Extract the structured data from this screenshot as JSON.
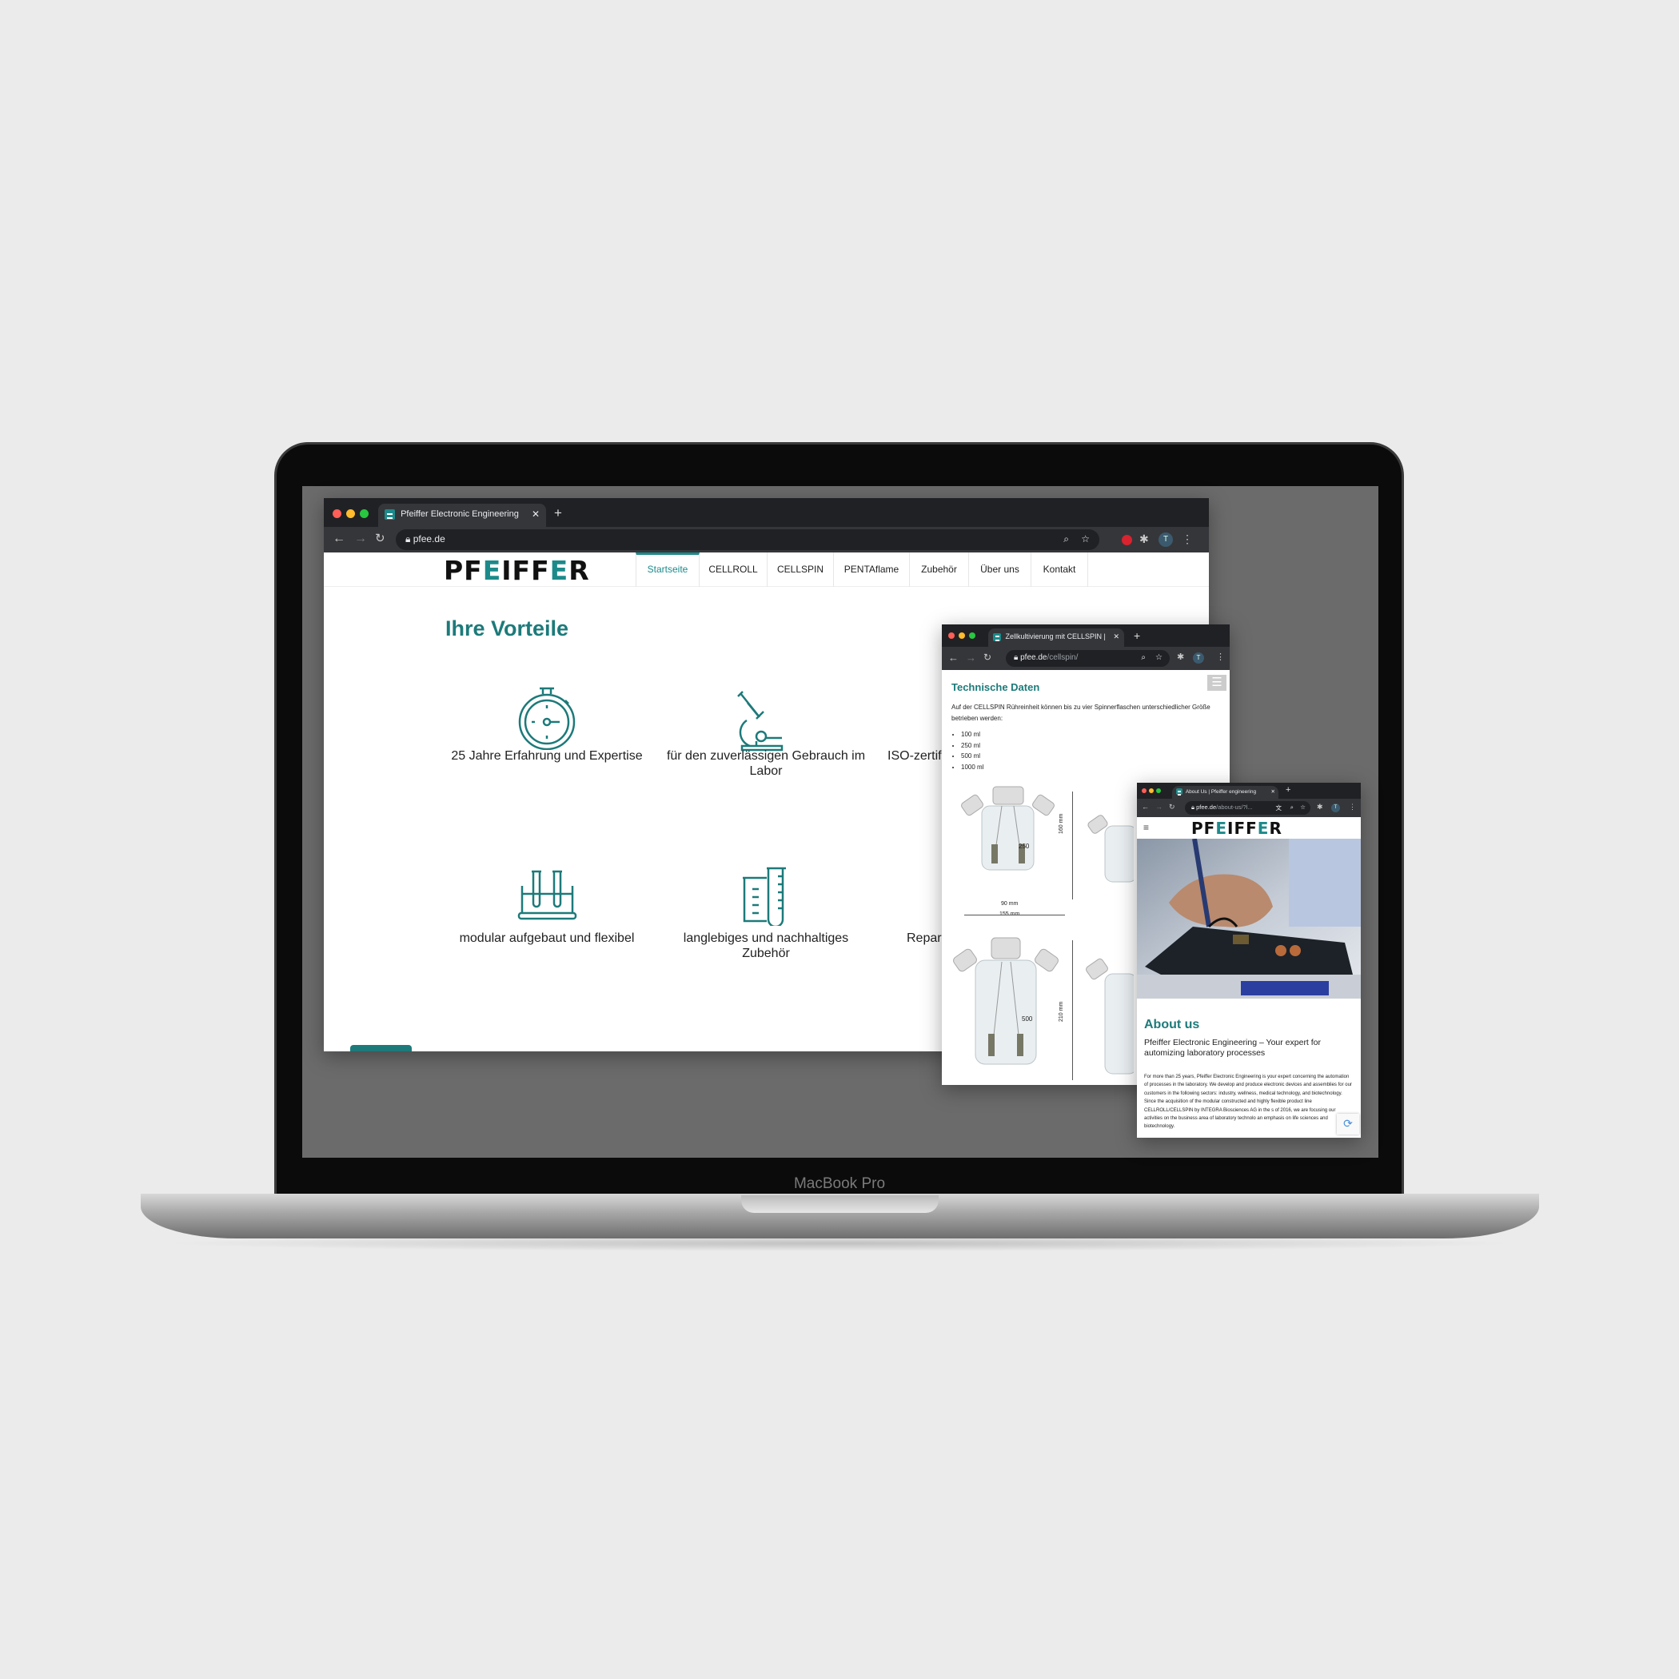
{
  "device": {
    "label": "MacBook Pro"
  },
  "colors": {
    "accent": "#1d7a7a",
    "browser_chrome": "#202124",
    "background": "#ebebeb"
  },
  "main_browser": {
    "tab_title": "Pfeiffer Electronic Engineering",
    "url": "pfee.de",
    "logo": {
      "pre": "PF",
      "e1": "E",
      "mid": "IFF",
      "e2": "E",
      "post": "R"
    },
    "nav": [
      "Startseite",
      "CELLROLL",
      "CELLSPIN",
      "PENTAflame",
      "Zubehör",
      "Über uns",
      "Kontakt"
    ],
    "active_nav": "Startseite",
    "heading": "Ihre Vorteile",
    "features": [
      {
        "icon": "stopwatch-icon",
        "text": "25 Jahre Erfahrung und Expertise"
      },
      {
        "icon": "microscope-icon",
        "text": "für den zuverlässigen Gebrauch im Labor"
      },
      {
        "icon": "certificate-icon",
        "text": "ISO-zertifi"
      },
      {
        "icon": "test-tube-rack-icon",
        "text": "modular aufgebaut und flexibel"
      },
      {
        "icon": "beaker-icon",
        "text": "langlebiges und nachhaltiges Zubehör"
      },
      {
        "icon": "repair-icon",
        "text": "Repar"
      }
    ],
    "avatar": "T"
  },
  "cellspin_browser": {
    "tab_title": "Zellkultivierung mit CELLSPIN |",
    "url_host": "pfee.de",
    "url_path": "/cellspin/",
    "heading": "Technische Daten",
    "intro": "Auf der CELLSPIN Rühreinheit können bis zu vier Spinnerflaschen unterschiedlicher Größe betrieben werden:",
    "sizes": [
      "100 ml",
      "250 ml",
      "500 ml",
      "1000 ml"
    ],
    "dimensions": {
      "height_250": "160 mm",
      "inner_width_250": "90 mm",
      "outer_width_250": "155 mm",
      "height_500": "210 mm",
      "mark_250": "250",
      "mark_500": "500"
    },
    "avatar": "T"
  },
  "about_browser": {
    "tab_title": "About Us | Pfeiffer engineering",
    "url_host": "pfee.de",
    "url_path": "/about-us/?l...",
    "heading": "About us",
    "subheading": "Pfeiffer Electronic Engineering – Your expert for automizing laboratory processes",
    "body": "For more than 25 years, Pfeiffer Electronic Engineering is your expert concerning the automation of processes in the laboratory. We develop and produce electronic devices and assemblies for our customers in the following sectors: industry, wellness, medical technology, and biotechnology. Since the acquisition of the modular constructed and highly flexible product line CELLROLL/CELLSPIN by INTEGRA Biosciences AG in the s of 2016, we are focusing our activities on the business area of laboratory technolo an emphasis on life sciences and biotechnology.",
    "avatar": "T"
  }
}
